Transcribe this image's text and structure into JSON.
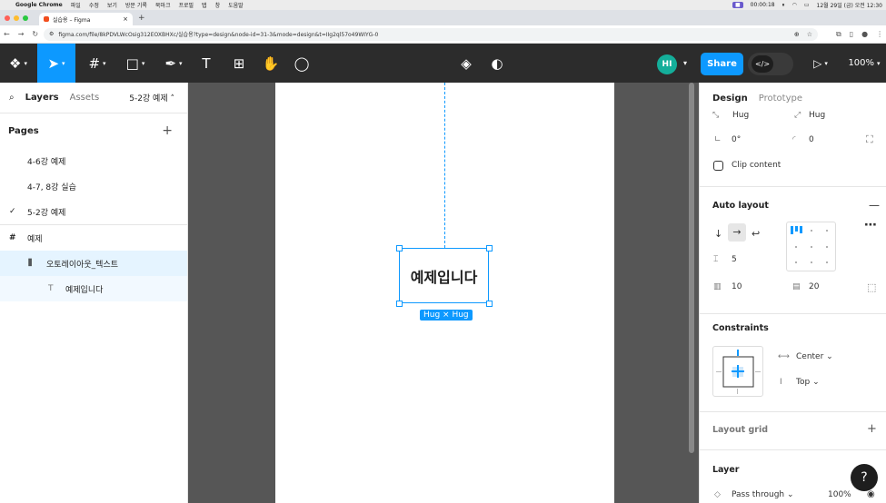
{
  "mac_menu": {
    "app": "Google Chrome",
    "items": [
      "파일",
      "수정",
      "보기",
      "방문 기록",
      "북마크",
      "프로필",
      "탭",
      "창",
      "도움말"
    ],
    "recording_time": "00:00:18",
    "datetime": "12월 29일 (금) 오전 12:30"
  },
  "tab": {
    "title": "실습용 – Figma",
    "close": "×",
    "new": "+"
  },
  "address": {
    "url": "figma.com/file/8kPDVLWcOsig312EOXBHXc/실습용?type=design&node-id=31-3&mode=design&t=IIg2ql57o49WIYG-0"
  },
  "toolbar": {
    "avatar": "HI",
    "share_label": "Share",
    "dev_label": "</>",
    "zoom": "100%"
  },
  "left_panel": {
    "tabs": [
      "Layers",
      "Assets"
    ],
    "current_page": "5-2강 예제",
    "pages_title": "Pages",
    "pages": [
      "4-6강 예제",
      "4-7, 8강 실습",
      "5-2강 예제"
    ],
    "layers": [
      {
        "label": "예제",
        "icon": "#"
      },
      {
        "label": "오토레이아웃_텍스트",
        "icon": "⫼"
      },
      {
        "label": "예제입니다",
        "icon": "T"
      }
    ]
  },
  "canvas": {
    "text": "예제입니다",
    "size_badge": "Hug × Hug"
  },
  "right_panel": {
    "tabs": [
      "Design",
      "Prototype"
    ],
    "hug_w": "Hug",
    "hug_h": "Hug",
    "rotation": "0°",
    "radius": "0",
    "clip_content": "Clip content",
    "auto_layout_title": "Auto layout",
    "gap": "5",
    "padding_h": "10",
    "padding_v": "20",
    "constraints_title": "Constraints",
    "constraint_h": "Center",
    "constraint_v": "Top",
    "layout_grid": "Layout grid",
    "layer_title": "Layer",
    "blend": "Pass through",
    "opacity": "100%"
  },
  "colors": {
    "accent": "#0d99ff",
    "toolbar": "#2c2c2c",
    "canvas": "#565656",
    "avatar": "#14ae9a"
  }
}
